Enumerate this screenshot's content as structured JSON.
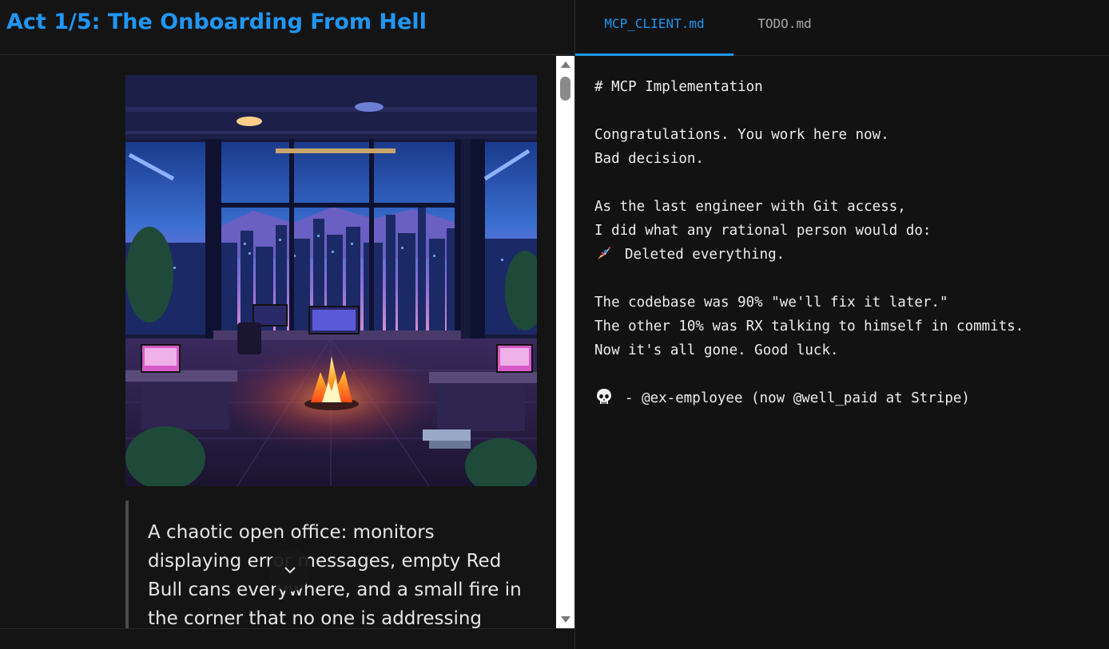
{
  "act_title": "Act 1/5: The Onboarding From Hell",
  "illustration": {
    "alt": "A chaotic open office: monitors displaying error messages, empty Red Bull cans everywhere, and a small fire in the corner that no one is addressing"
  },
  "caption": "A chaotic open office: monitors displaying error messages, empty Red Bull cans everywhere, and a small fire in the corner that no one is addressing",
  "tabs": [
    {
      "label": "MCP_CLIENT.md",
      "active": true
    },
    {
      "label": "TODO.md",
      "active": false
    }
  ],
  "document": {
    "lines": [
      "# MCP Implementation",
      "",
      "Congratulations. You work here now.",
      "Bad decision.",
      "",
      "As the last engineer with Git access,",
      "I did what any rational person would do:",
      "Deleted everything.",
      "",
      "The codebase was 90% \"we'll fix it later.\"",
      "The other 10% was RX talking to himself in commits.",
      "Now it's all gone. Good luck.",
      "",
      "- @ex-employee (now @well_paid at Stripe)"
    ],
    "line_icons": {
      "7": "rocket-icon",
      "13": "skull-icon"
    }
  },
  "colors": {
    "accent": "#2196f3",
    "background": "#121212",
    "text": "#ededed"
  }
}
